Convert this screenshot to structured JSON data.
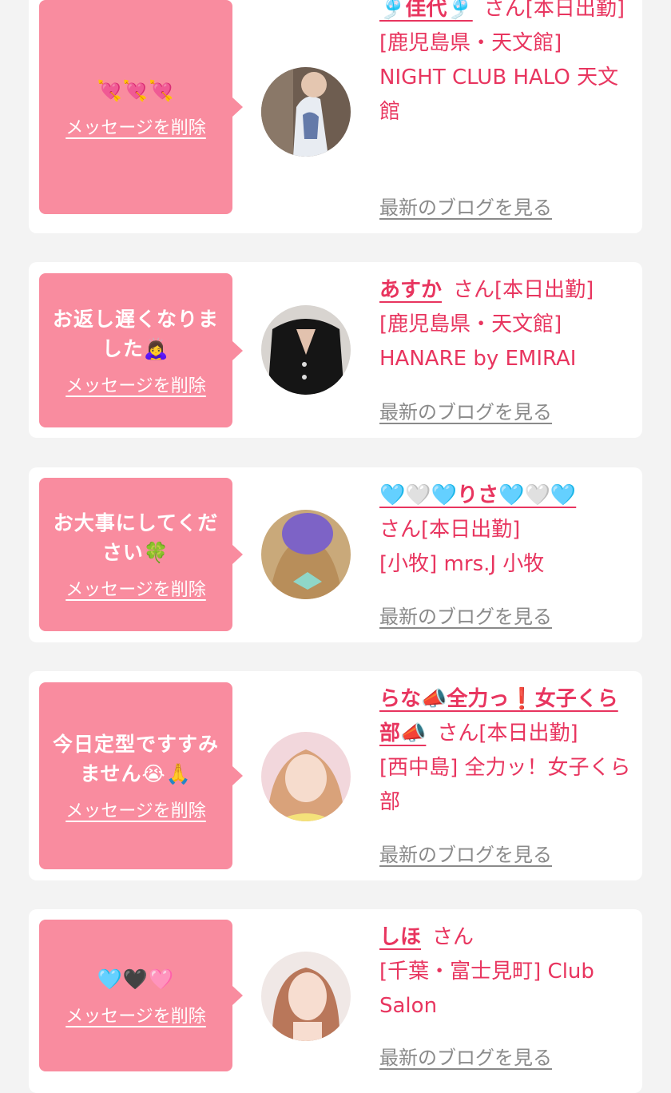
{
  "colors": {
    "accent": "#e8355f",
    "bubble": "#f98c9f",
    "background": "#f3f3f3",
    "link_gray": "#8a8a8a"
  },
  "delete_label": "メッセージを削除",
  "blog_label": "最新のブログを見る",
  "suffix": "さん",
  "cards": [
    {
      "message": "💘💘💘",
      "name": "🎐佳代🎐",
      "status": "[本日出勤]",
      "shop": "[鹿児島県・天文館] NIGHT CLUB HALO 天文館"
    },
    {
      "message": "お返し遅くなりました🙇‍♀️",
      "name": "あすか",
      "status": "[本日出勤]",
      "shop": "[鹿児島県・天文館] HANARE by EMIRAI"
    },
    {
      "message": "お大事にしてください🍀",
      "name": "🩵🤍🩵りさ🩵🤍🩵",
      "status": "[本日出勤]",
      "shop": "[小牧] mrs.J 小牧"
    },
    {
      "message": "今日定型ですすみません😭🙏",
      "name": "らな📣全力っ❗️女子くら部📣",
      "status": "[本日出勤]",
      "shop": "[西中島] 全力ッ！女子くら部"
    },
    {
      "message": "🩵🖤🩷",
      "name": "しほ",
      "status": "",
      "shop": "[千葉・富士見町] Club Salon"
    }
  ]
}
